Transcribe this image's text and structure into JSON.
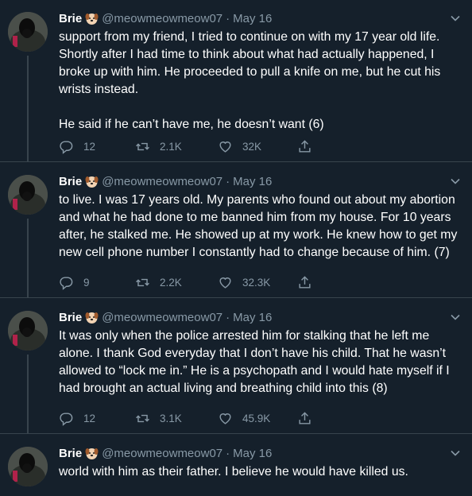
{
  "tweets": [
    {
      "name": "Brie",
      "handle": "@meowmeowmeow07",
      "dot": "·",
      "date": "May 16",
      "text": "support from my friend, I tried to continue on with my 17 year old life. Shortly after I had time to think about what had actually happened, I broke up with him. He proceeded to pull a knife on me, but he cut his wrists instead.\n\nHe said if he can’t have me, he doesn’t want (6)",
      "replies": "12",
      "retweets": "2.1K",
      "likes": "32K"
    },
    {
      "name": "Brie",
      "handle": "@meowmeowmeow07",
      "dot": "·",
      "date": "May 16",
      "text": "to live. I was 17 years old. My parents who found out about my abortion and what he had done to me banned him from my house. For 10 years after, he stalked me. He showed up at my work. He knew how to get my new cell phone number I constantly had to change because of him. (7)",
      "replies": "9",
      "retweets": "2.2K",
      "likes": "32.3K"
    },
    {
      "name": "Brie",
      "handle": "@meowmeowmeow07",
      "dot": "·",
      "date": "May 16",
      "text": "It was only when the police arrested him for stalking that he left me alone. I thank God everyday that I don’t have his child. That he wasn’t allowed to “lock me in.” He is a psychopath and I would hate myself if I had brought an actual living and breathing child into this (8)",
      "replies": "12",
      "retweets": "3.1K",
      "likes": "45.9K"
    },
    {
      "name": "Brie",
      "handle": "@meowmeowmeow07",
      "dot": "·",
      "date": "May 16",
      "text": "world with him as their father. I believe he would have killed us."
    }
  ],
  "colors": {
    "background": "#15202b",
    "secondary_text": "#8899a6",
    "divider": "#38444d",
    "primary_text": "#ffffff"
  },
  "icons": [
    "reply-icon",
    "retweet-icon",
    "like-icon",
    "share-icon",
    "chevron-down-icon",
    "dog-emoji-icon"
  ]
}
